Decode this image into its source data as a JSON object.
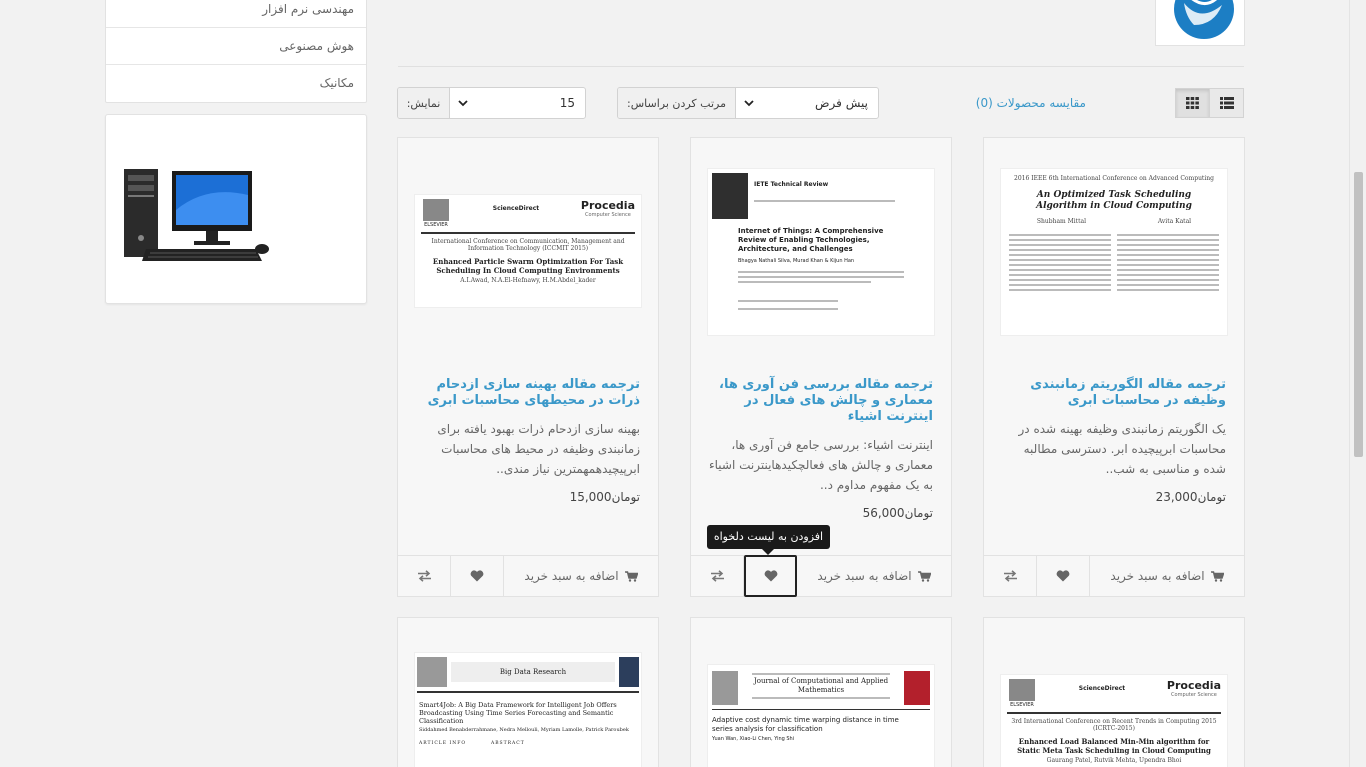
{
  "sidebar": {
    "categories": [
      "مهندسی نرم افزار",
      "هوش مصنوعی",
      "مکانیک"
    ]
  },
  "toolbar": {
    "compare_label": "مقایسه محصولات (0)",
    "sort_label": "مرتب کردن براساس:",
    "sort_value": "پیش فرض",
    "show_label": "نمایش:",
    "show_value": "15",
    "view_modes": [
      "grid",
      "list"
    ],
    "active_view": "grid"
  },
  "tooltip": "افزودن به لیست دلخواه",
  "product_actions": {
    "cart_label": "اضافه به سبد خرید"
  },
  "products": [
    {
      "title": "ترجمه مقاله الگوریتم زمانبندی وظیفه در محاسبات ابری",
      "description": "یک الگوریتم زمانبندی وظیفه بهینه شده در محاسبات ابرپیچیده ابر. دسترسی مطالبه شده و مناسبی به شب..",
      "price": "23,000",
      "currency": "تومان",
      "thumb": {
        "header": "2016 IEEE 6th International Conference on Advanced Computing",
        "title": "An Optimized Task Scheduling Algorithm in Cloud Computing",
        "authors_left": "Shubham Mittal",
        "authors_right": "Avita Katal"
      }
    },
    {
      "title": "ترجمه مقاله بررسی فن آوری ها، معماری و چالش های فعال در اینترنت اشیاء",
      "description": "اینترنت اشیاء: بررسی جامع فن آوری ها، معماری و چالش های فعالچکیدهاینترنت اشیاء به یک مفهوم مداوم د..",
      "price": "56,000",
      "currency": "تومان",
      "thumb": {
        "journal": "IETE Technical Review",
        "title": "Internet of Things: A Comprehensive Review of Enabling Technologies, Architecture, and Challenges",
        "authors": "Bhagya Nathali Silva, Murad Khan & Kijun Han"
      }
    },
    {
      "title": "ترجمه مقاله بهینه سازی ازدحام ذرات در محیطهای محاسبات ابری",
      "description": "بهینه سازی ازدحام ذرات بهبود یافته برای زمانبندی وظیفه در محیط های محاسبات ابرپیچیدهمهمترین نیاز مندی..",
      "price": "15,000",
      "currency": "تومان",
      "thumb": {
        "publisher": "ELSEVIER",
        "source": "ScienceDirect",
        "journal": "Procedia",
        "journal_sub": "Computer Science",
        "conference": "International Conference on Communication, Management and Information Technology (ICCMIT 2015)",
        "title": "Enhanced Particle Swarm Optimization For Task Scheduling In Cloud Computing Environments",
        "authors": "A.I.Awad, N.A.El-Hefnawy, H.M.Abdel_kader"
      }
    },
    {
      "thumb": {
        "publisher": "ELSEVIER",
        "source": "ScienceDirect",
        "journal": "Procedia",
        "journal_sub": "Computer Science",
        "conference": "3rd International Conference on Recent Trends in Computing 2015 (ICRTC-2015)",
        "title": "Enhanced Load Balanced Min-Min algorithm for Static Meta Task Scheduling in Cloud Computing",
        "authors": "Gaurang Patel, Rutvik Mehta, Upendra Bhoi"
      }
    },
    {
      "thumb": {
        "journal": "Journal of Computational and Applied Mathematics",
        "title": "Adaptive cost dynamic time warping distance in time series analysis for classification",
        "authors": "Yuan Wan, Xiao-Li Chen, Ying Shi"
      }
    },
    {
      "thumb": {
        "journal": "Big Data Research",
        "title": "Smart4Job: A Big Data Framework for Intelligent Job Offers Broadcasting Using Time Series Forecasting and Semantic Classification",
        "authors": "Siddahmed Benabderrahmane, Nedra Mellouli, Myriam Lamolle, Patrick Paroubek",
        "section_left": "ARTICLE INFO",
        "section_right": "ABSTRACT"
      }
    }
  ]
}
